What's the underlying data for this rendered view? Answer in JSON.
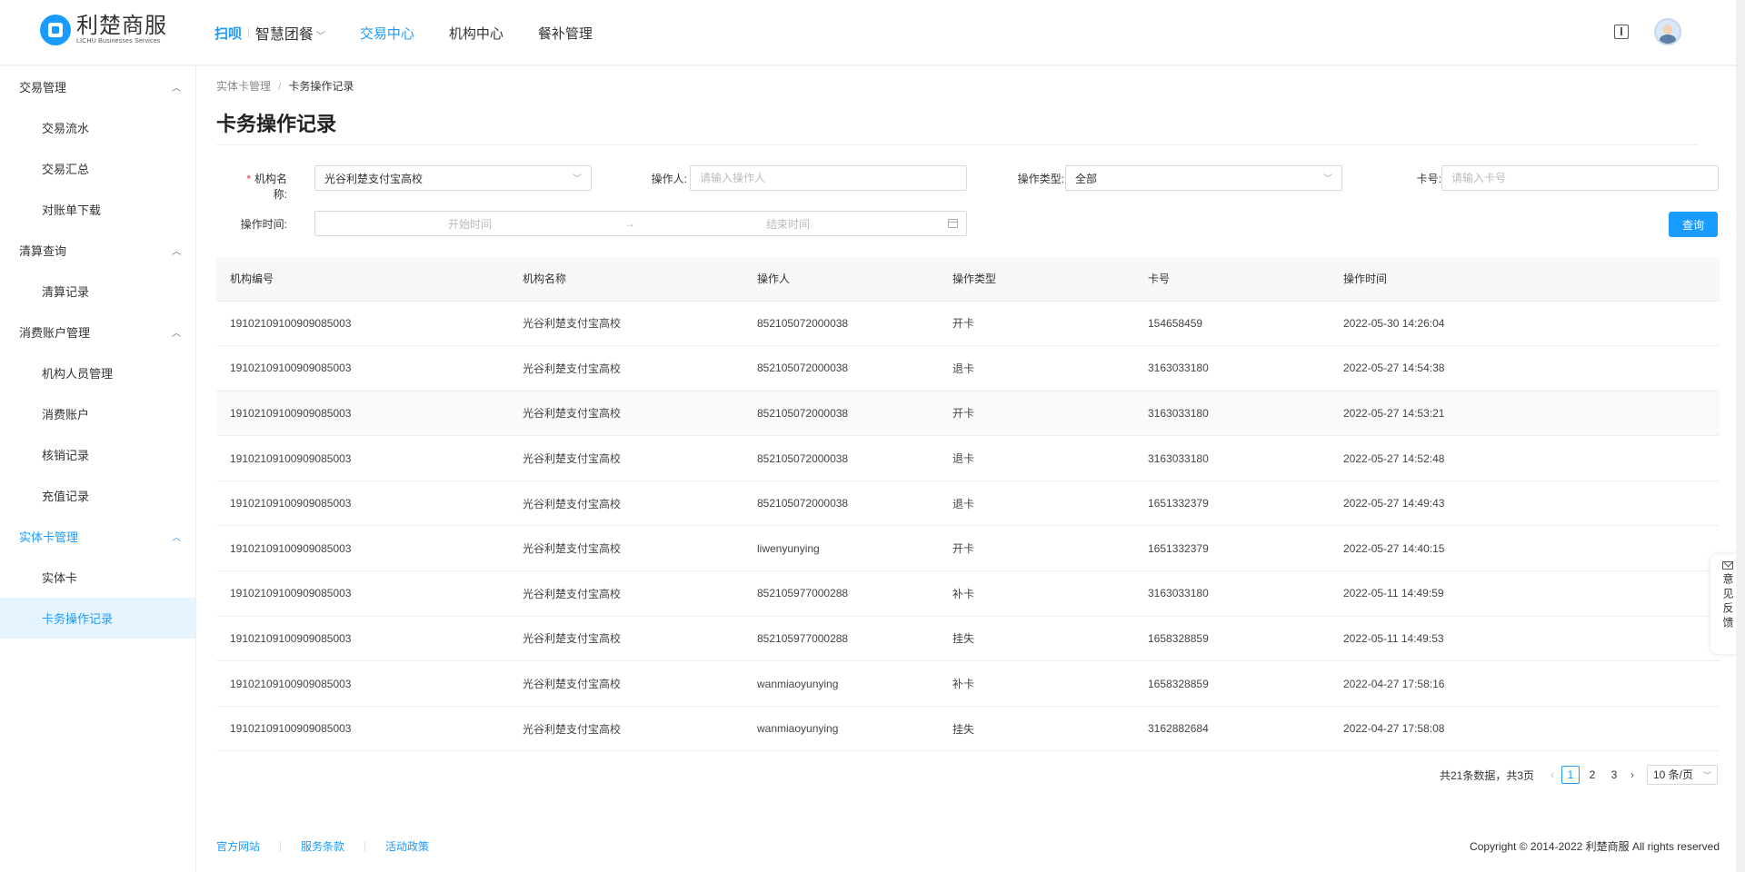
{
  "logo": {
    "cn": "利楚商服",
    "en": "LICHU Businesses Services"
  },
  "nav": {
    "brand_a": "扫呗",
    "brand_b": "智慧团餐",
    "items": [
      "交易中心",
      "机构中心",
      "餐补管理"
    ],
    "active_index": 0
  },
  "sidebar": {
    "groups": [
      {
        "label": "交易管理",
        "items": [
          "交易流水",
          "交易汇总",
          "对账单下载"
        ]
      },
      {
        "label": "清算查询",
        "items": [
          "清算记录"
        ]
      },
      {
        "label": "消费账户管理",
        "items": [
          "机构人员管理",
          "消费账户",
          "核销记录",
          "充值记录"
        ]
      },
      {
        "label": "实体卡管理",
        "items": [
          "实体卡",
          "卡务操作记录"
        ]
      }
    ],
    "selected": "卡务操作记录"
  },
  "breadcrumb": {
    "parent": "实体卡管理",
    "separator": "/",
    "current": "卡务操作记录"
  },
  "page_title": "卡务操作记录",
  "filters": {
    "org_name_label": "机构名称",
    "org_name_value": "光谷利楚支付宝高校",
    "operator_label": "操作人",
    "operator_placeholder": "请输入操作人",
    "op_type_label": "操作类型",
    "op_type_value": "全部",
    "card_no_label": "卡号",
    "card_no_placeholder": "请输入卡号",
    "op_time_label": "操作时间",
    "start_placeholder": "开始时间",
    "range_arrow": "→",
    "end_placeholder": "结束时间",
    "query_button": "查询"
  },
  "table": {
    "columns": [
      "机构编号",
      "机构名称",
      "操作人",
      "操作类型",
      "卡号",
      "操作时间"
    ],
    "rows": [
      [
        "19102109100909085003",
        "光谷利楚支付宝高校",
        "852105072000038",
        "开卡",
        "154658459",
        "2022-05-30 14:26:04"
      ],
      [
        "19102109100909085003",
        "光谷利楚支付宝高校",
        "852105072000038",
        "退卡",
        "3163033180",
        "2022-05-27 14:54:38"
      ],
      [
        "19102109100909085003",
        "光谷利楚支付宝高校",
        "852105072000038",
        "开卡",
        "3163033180",
        "2022-05-27 14:53:21"
      ],
      [
        "19102109100909085003",
        "光谷利楚支付宝高校",
        "852105072000038",
        "退卡",
        "3163033180",
        "2022-05-27 14:52:48"
      ],
      [
        "19102109100909085003",
        "光谷利楚支付宝高校",
        "852105072000038",
        "退卡",
        "1651332379",
        "2022-05-27 14:49:43"
      ],
      [
        "19102109100909085003",
        "光谷利楚支付宝高校",
        "liwenyunying",
        "开卡",
        "1651332379",
        "2022-05-27 14:40:15"
      ],
      [
        "19102109100909085003",
        "光谷利楚支付宝高校",
        "852105977000288",
        "补卡",
        "3163033180",
        "2022-05-11 14:49:59"
      ],
      [
        "19102109100909085003",
        "光谷利楚支付宝高校",
        "852105977000288",
        "挂失",
        "1658328859",
        "2022-05-11 14:49:53"
      ],
      [
        "19102109100909085003",
        "光谷利楚支付宝高校",
        "wanmiaoyunying",
        "补卡",
        "1658328859",
        "2022-04-27 17:58:16"
      ],
      [
        "19102109100909085003",
        "光谷利楚支付宝高校",
        "wanmiaoyunying",
        "挂失",
        "3162882684",
        "2022-04-27 17:58:08"
      ]
    ],
    "highlighted_row": 2
  },
  "pagination": {
    "summary": "共21条数据，共3页",
    "prev": "‹",
    "pages": [
      "1",
      "2",
      "3"
    ],
    "current": "1",
    "next": "›",
    "page_size": "10 条/页"
  },
  "footer": {
    "links": [
      "官方网站",
      "服务条款",
      "活动政策"
    ],
    "copyright": "Copyright © 2014-2022 利楚商服 All rights reserved"
  },
  "feedback": {
    "label": "意见反馈"
  },
  "colors": {
    "primary": "#1a9bff",
    "required": "#f5222d"
  }
}
